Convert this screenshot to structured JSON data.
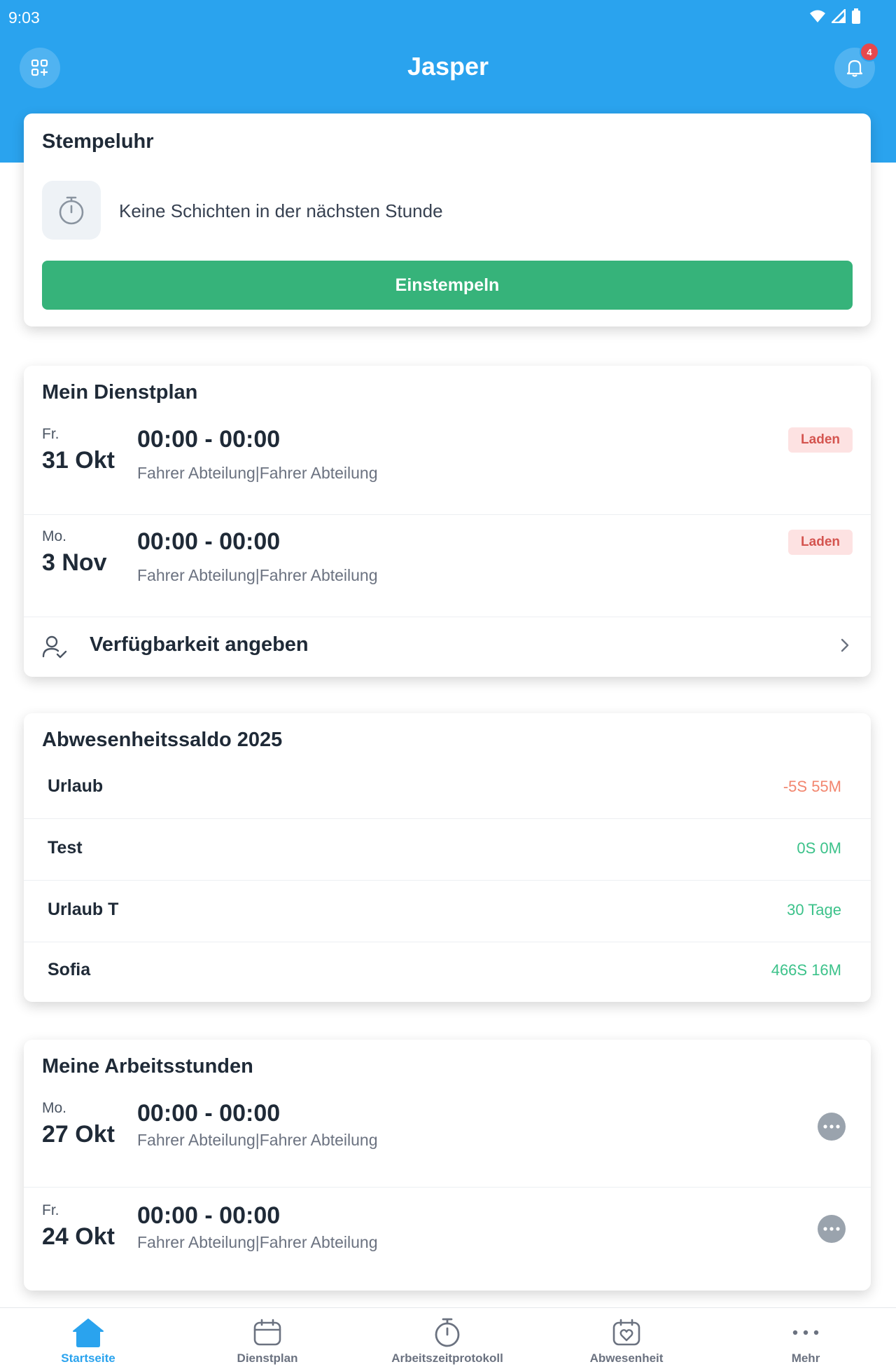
{
  "status_bar": {
    "time": "9:03"
  },
  "header": {
    "title": "Jasper",
    "notification_count": "4"
  },
  "clock_card": {
    "title": "Stempeluhr",
    "message": "Keine Schichten in der nächsten Stunde",
    "button_label": "Einstempeln"
  },
  "schedule_card": {
    "title": "Mein Dienstplan",
    "shifts": [
      {
        "dow": "Fr.",
        "date": "31 Okt",
        "time": "00:00 - 00:00",
        "dept": "Fahrer Abteilung|Fahrer Abteilung",
        "tag": "Laden"
      },
      {
        "dow": "Mo.",
        "date": "3 Nov",
        "time": "00:00 - 00:00",
        "dept": "Fahrer Abteilung|Fahrer Abteilung",
        "tag": "Laden"
      }
    ],
    "availability_label": "Verfügbarkeit angeben"
  },
  "balance_card": {
    "title": "Abwesenheitssaldo 2025",
    "rows": [
      {
        "label": "Urlaub",
        "value": "-5S 55M",
        "color": "#f2866f"
      },
      {
        "label": "Test",
        "value": "0S 0M",
        "color": "#3cc28a"
      },
      {
        "label": "Urlaub T",
        "value": "30 Tage",
        "color": "#3cc28a"
      },
      {
        "label": "Sofia",
        "value": "466S 16M",
        "color": "#3cc28a"
      }
    ]
  },
  "hours_card": {
    "title": "Meine Arbeitsstunden",
    "entries": [
      {
        "dow": "Mo.",
        "date": "27 Okt",
        "time": "00:00 - 00:00",
        "dept": "Fahrer Abteilung|Fahrer Abteilung"
      },
      {
        "dow": "Fr.",
        "date": "24 Okt",
        "time": "00:00 - 00:00",
        "dept": "Fahrer Abteilung|Fahrer Abteilung"
      }
    ]
  },
  "bottom_nav": {
    "items": [
      {
        "label": "Startseite",
        "icon": "home-icon",
        "active": true
      },
      {
        "label": "Dienstplan",
        "icon": "calendar-icon",
        "active": false
      },
      {
        "label": "Arbeitszeitprotokoll",
        "icon": "stopwatch-icon",
        "active": false
      },
      {
        "label": "Abwesenheit",
        "icon": "calendar-heart-icon",
        "active": false
      },
      {
        "label": "Mehr",
        "icon": "more-icon",
        "active": false
      }
    ]
  },
  "colors": {
    "primary": "#2aa3ee",
    "success": "#36b37a",
    "tag_bg": "#fde2e2",
    "tag_text": "#d4544f"
  }
}
